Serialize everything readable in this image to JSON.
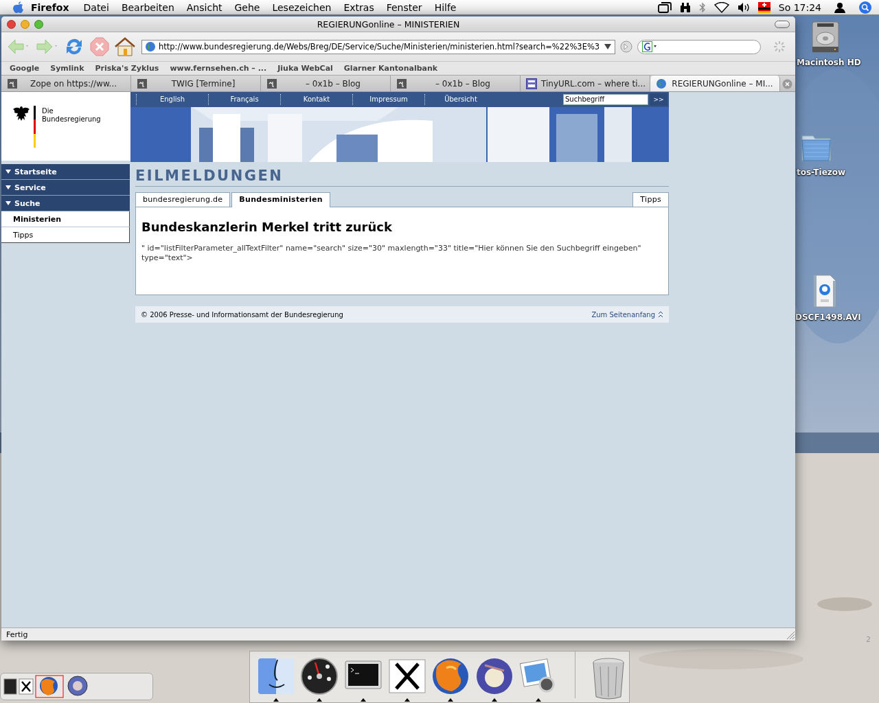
{
  "menubar": {
    "app": "Firefox",
    "menus": [
      "Datei",
      "Bearbeiten",
      "Ansicht",
      "Gehe",
      "Lesezeichen",
      "Extras",
      "Fenster",
      "Hilfe"
    ],
    "clock": "So 17:24"
  },
  "desktop": {
    "icons": [
      {
        "kind": "disk",
        "label": "Macintosh HD"
      },
      {
        "kind": "folder",
        "label": "tos-Tiezow"
      },
      {
        "kind": "movie",
        "label": "DSCF1498.AVI"
      }
    ],
    "corner_text": "2"
  },
  "window": {
    "title": "REGIERUNGonline – MINISTERIEN",
    "url": "http://www.bundesregierung.de/Webs/Breg/DE/Service/Suche/Ministerien/ministerien.html?search=%22%3E%3",
    "bookmarks": [
      "Google",
      "Symlink",
      "Priska's Zyklus",
      "www.fernsehen.ch – ...",
      "Jiuka WebCal",
      "Glarner Kantonalbank"
    ],
    "tabs": [
      {
        "label": "Zope on https://ww...",
        "kind": "terminal",
        "selected": false
      },
      {
        "label": "TWIG [Termine]",
        "kind": "terminal",
        "selected": false
      },
      {
        "label": "– 0x1b – Blog",
        "kind": "terminal",
        "selected": false
      },
      {
        "label": "– 0x1b – Blog",
        "kind": "terminal",
        "selected": false
      },
      {
        "label": "TinyURL.com – where ti...",
        "kind": "tinyurl",
        "selected": false
      },
      {
        "label": "REGIERUNGonline – MI...",
        "kind": "globe",
        "selected": true
      }
    ],
    "status": "Fertig"
  },
  "page": {
    "logo_lines": [
      "Die",
      "Bundesregierung"
    ],
    "top_links": [
      "English",
      "Français",
      "Kontakt",
      "Impressum",
      "Übersicht"
    ],
    "search": {
      "value": "Suchbegriff",
      "button": ">>"
    },
    "nav": [
      {
        "label": "Startseite",
        "kind": "section",
        "selected": false
      },
      {
        "label": "Service",
        "kind": "section",
        "selected": false
      },
      {
        "label": "Suche",
        "kind": "section",
        "selected": false
      },
      {
        "label": "Ministerien",
        "kind": "link",
        "selected": true
      },
      {
        "label": "Tipps",
        "kind": "link",
        "selected": false
      }
    ],
    "heading": "EILMELDUNGEN",
    "tabs": [
      {
        "label": "bundesregierung.de",
        "selected": false
      },
      {
        "label": "Bundesministerien",
        "selected": true
      },
      {
        "label": "Tipps",
        "selected": false
      }
    ],
    "article": {
      "title": "Bundeskanzlerin Merkel tritt zurück",
      "text": "\" id=\"listFilterParameter_allTextFilter\" name=\"search\" size=\"30\" maxlength=\"33\" title=\"Hier können Sie den Suchbegriff eingeben\" type=\"text\">"
    },
    "footer": {
      "copyright": "© 2006 Presse- und Informationsamt der Bundesregierung",
      "top_link": "Zum Seitenanfang"
    }
  }
}
